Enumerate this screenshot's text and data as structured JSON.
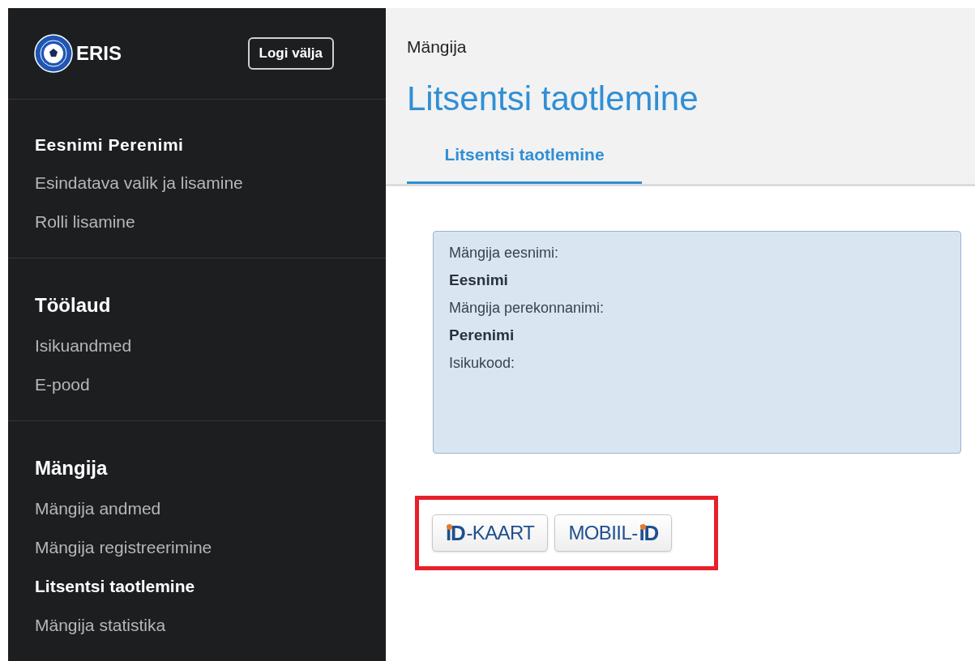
{
  "sidebar": {
    "brand": "ERIS",
    "logout_button": "Logi välja",
    "groups": [
      {
        "title": "Eesnimi Perenimi",
        "kind": "user",
        "items": [
          {
            "label": "Esindatava valik ja lisamine",
            "selected": false
          },
          {
            "label": "Rolli lisamine",
            "selected": false
          }
        ]
      },
      {
        "title": "Töölaud",
        "kind": "section",
        "items": [
          {
            "label": "Isikuandmed",
            "selected": false
          },
          {
            "label": "E-pood",
            "selected": false
          }
        ]
      },
      {
        "title": "Mängija",
        "kind": "section",
        "items": [
          {
            "label": "Mängija andmed",
            "selected": false
          },
          {
            "label": "Mängija registreerimine",
            "selected": false
          },
          {
            "label": "Litsentsi taotlemine",
            "selected": true
          },
          {
            "label": "Mängija statistika",
            "selected": false
          }
        ]
      }
    ]
  },
  "header": {
    "breadcrumb": "Mängija",
    "title": "Litsentsi taotlemine",
    "tabs": [
      {
        "label": "Litsentsi taotlemine",
        "selected": true
      }
    ]
  },
  "info_box": [
    {
      "kind": "label",
      "text": "Mängija eesnimi:"
    },
    {
      "kind": "value",
      "text": "Eesnimi"
    },
    {
      "kind": "label",
      "text": "Mängija perekonnanimi:"
    },
    {
      "kind": "value",
      "text": "Perenimi"
    },
    {
      "kind": "label",
      "text": "Isikukood:"
    }
  ],
  "auth_buttons": [
    {
      "logo": "iD",
      "label": "-KAART",
      "logo_first": true
    },
    {
      "logo": "iD",
      "label": "MOBIIL-",
      "logo_first": false
    }
  ],
  "highlighted": true
}
